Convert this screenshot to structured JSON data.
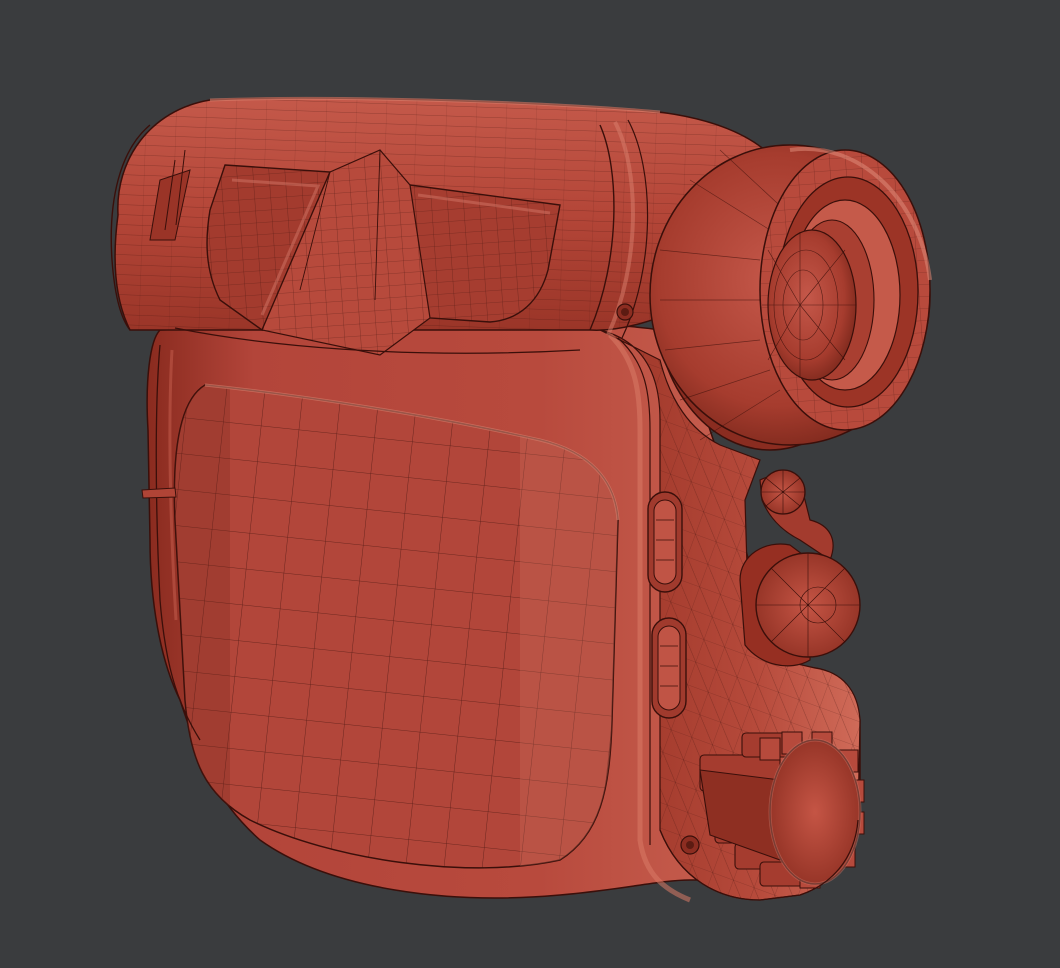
{
  "scene": {
    "subject": "rangefinder-wireframe-model",
    "colors": {
      "background": "#3a3c3e",
      "surface": "#b8483a",
      "surface_light": "#cf6a58",
      "surface_dark": "#6e2218",
      "wire": "#3a0f0a"
    }
  }
}
